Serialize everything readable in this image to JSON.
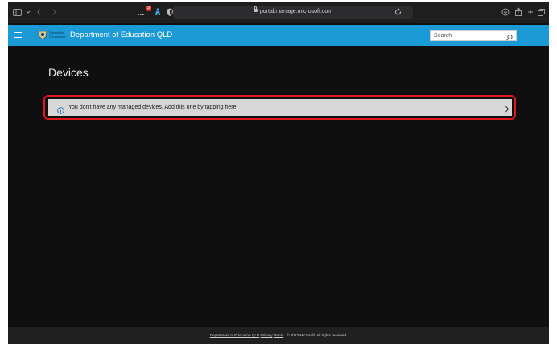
{
  "browser": {
    "url": "portal.manage.microsoft.com",
    "notification_count": "3"
  },
  "header": {
    "logo_text_line1": "Queensland",
    "logo_text_line2": "Government",
    "title": "Department of Education QLD",
    "search_placeholder": "Search"
  },
  "main": {
    "page_title": "Devices",
    "notice": "You don't have any managed devices. Add this one by tapping here."
  },
  "footer": {
    "link_org": "Department of Education QLD",
    "link_privacy": "Privacy",
    "link_terms": "Terms",
    "copyright": "© 2023 Microsoft. All rights reserved."
  },
  "colors": {
    "header_bg": "#1c9ad6",
    "highlight_border": "#e1191f",
    "notice_bg": "#d7d7d7",
    "page_bg": "#0f0f0f"
  }
}
